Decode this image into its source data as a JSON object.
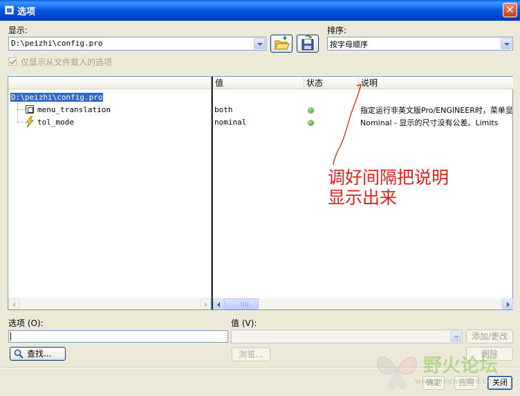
{
  "window": {
    "title": "选项",
    "close_label": "✕"
  },
  "display": {
    "label": "显示:",
    "value": "D:\\peizhi\\config.pro"
  },
  "sort": {
    "label": "排序:",
    "value": "按字母顺序"
  },
  "show_loaded_only": {
    "label": "仅显示从文件载入的选项",
    "checked": true,
    "enabled": false
  },
  "tree": {
    "root": "D:\\peizhi\\config.pro",
    "items": [
      {
        "label": "menu_translation",
        "icon": "option-node-icon"
      },
      {
        "label": "tol_mode",
        "icon": "lightning-icon"
      }
    ]
  },
  "table": {
    "columns": [
      "值",
      "状态",
      "说明"
    ],
    "rows": [
      {
        "value": "both",
        "status": "green",
        "description": "指定运行非英文版Pro/ENGINEER时，菜单显"
      },
      {
        "value": "nominal",
        "status": "green",
        "description": "Nominal - 显示的尺寸没有公差。Limits"
      }
    ]
  },
  "option_field": {
    "label": "选项 (O):",
    "value": ""
  },
  "value_field": {
    "label": "值 (V):",
    "value": ""
  },
  "buttons": {
    "add_change": "添加/更改",
    "find": "查找...",
    "browse": "浏览...",
    "delete": "删除",
    "ok": "确定",
    "apply": "应用",
    "close": "关闭"
  },
  "annotation": {
    "line1": "调好间隔把说明",
    "line2": "显示出来",
    "color": "#E0201B"
  },
  "watermark": {
    "text": "野火论坛",
    "url": "www.proewildfire.cn"
  },
  "colors": {
    "titlebar": "#0058E0",
    "selection": "#316AC5",
    "status_ok": "#3C8F2E"
  }
}
